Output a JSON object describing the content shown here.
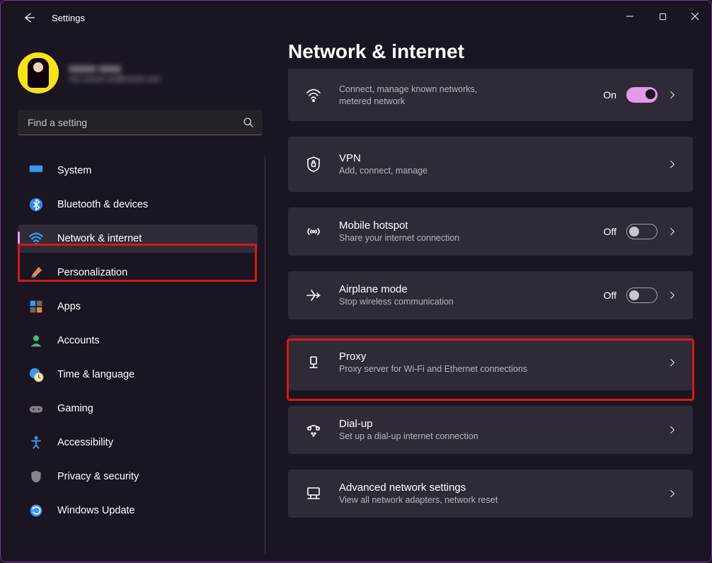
{
  "app": {
    "title": "Settings"
  },
  "profile": {
    "name": "xxxxx xxxx",
    "email": "xxx.xxxxx.xx@xxxxx.xxx"
  },
  "search": {
    "placeholder": "Find a setting"
  },
  "sidebar": {
    "items": [
      {
        "label": "System"
      },
      {
        "label": "Bluetooth & devices"
      },
      {
        "label": "Network & internet"
      },
      {
        "label": "Personalization"
      },
      {
        "label": "Apps"
      },
      {
        "label": "Accounts"
      },
      {
        "label": "Time & language"
      },
      {
        "label": "Gaming"
      },
      {
        "label": "Accessibility"
      },
      {
        "label": "Privacy & security"
      },
      {
        "label": "Windows Update"
      }
    ],
    "selected_index": 2
  },
  "main": {
    "title": "Network & internet",
    "cards": [
      {
        "title": "Wi-Fi",
        "sub": "Connect, manage known networks, metered network",
        "state_label": "On",
        "state_on": true
      },
      {
        "title": "VPN",
        "sub": "Add, connect, manage"
      },
      {
        "title": "Mobile hotspot",
        "sub": "Share your internet connection",
        "state_label": "Off",
        "state_on": false
      },
      {
        "title": "Airplane mode",
        "sub": "Stop wireless communication",
        "state_label": "Off",
        "state_on": false
      },
      {
        "title": "Proxy",
        "sub": "Proxy server for Wi-Fi and Ethernet connections"
      },
      {
        "title": "Dial-up",
        "sub": "Set up a dial-up internet connection"
      },
      {
        "title": "Advanced network settings",
        "sub": "View all network adapters, network reset"
      }
    ]
  }
}
